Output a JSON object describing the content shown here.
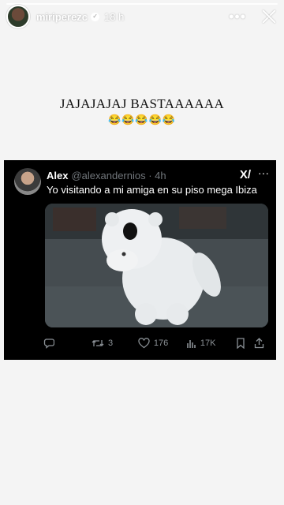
{
  "story": {
    "username": "miriperezc",
    "time": "18 h",
    "caption": "JAJAJAJAJ BASTAAAAAA",
    "emojis": "😂😂😂😂😂"
  },
  "tweet": {
    "name": "Alex",
    "handle": "@alexandernios · 4h",
    "text": "Yo visitando a mi amiga en su piso mega Ibiza",
    "retweets": "3",
    "likes": "176",
    "views": "17K"
  }
}
